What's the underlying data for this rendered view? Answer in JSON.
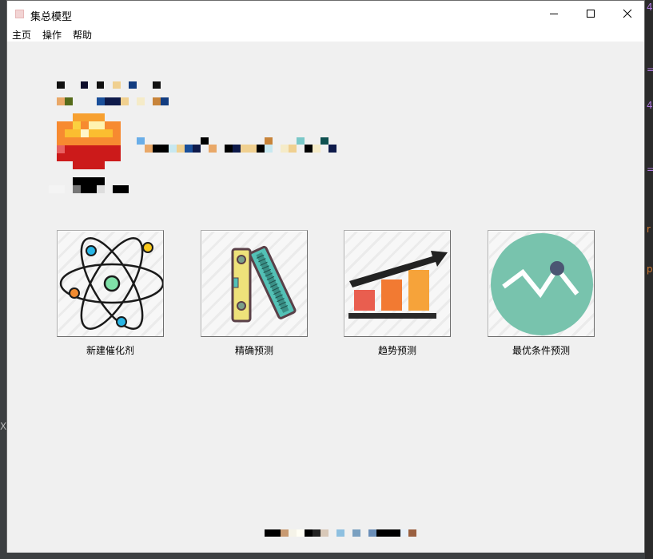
{
  "window": {
    "title": "集总模型"
  },
  "menu": [
    {
      "label": "主页"
    },
    {
      "label": "操作"
    },
    {
      "label": "帮助"
    }
  ],
  "tools": [
    {
      "label": "新建催化剂",
      "icon": "atom-icon"
    },
    {
      "label": "精确预测",
      "icon": "level-ruler-icon"
    },
    {
      "label": "趋势预测",
      "icon": "trend-chart-icon"
    },
    {
      "label": "最优条件预测",
      "icon": "optimum-wave-icon"
    }
  ],
  "colors": {
    "window_bg": "#f0f0f0",
    "atom_ring": "#1a1a1a",
    "wave_circle": "#78c3ad",
    "bar_colors": [
      "#e95e4f",
      "#f27a32",
      "#f6a33a"
    ]
  }
}
